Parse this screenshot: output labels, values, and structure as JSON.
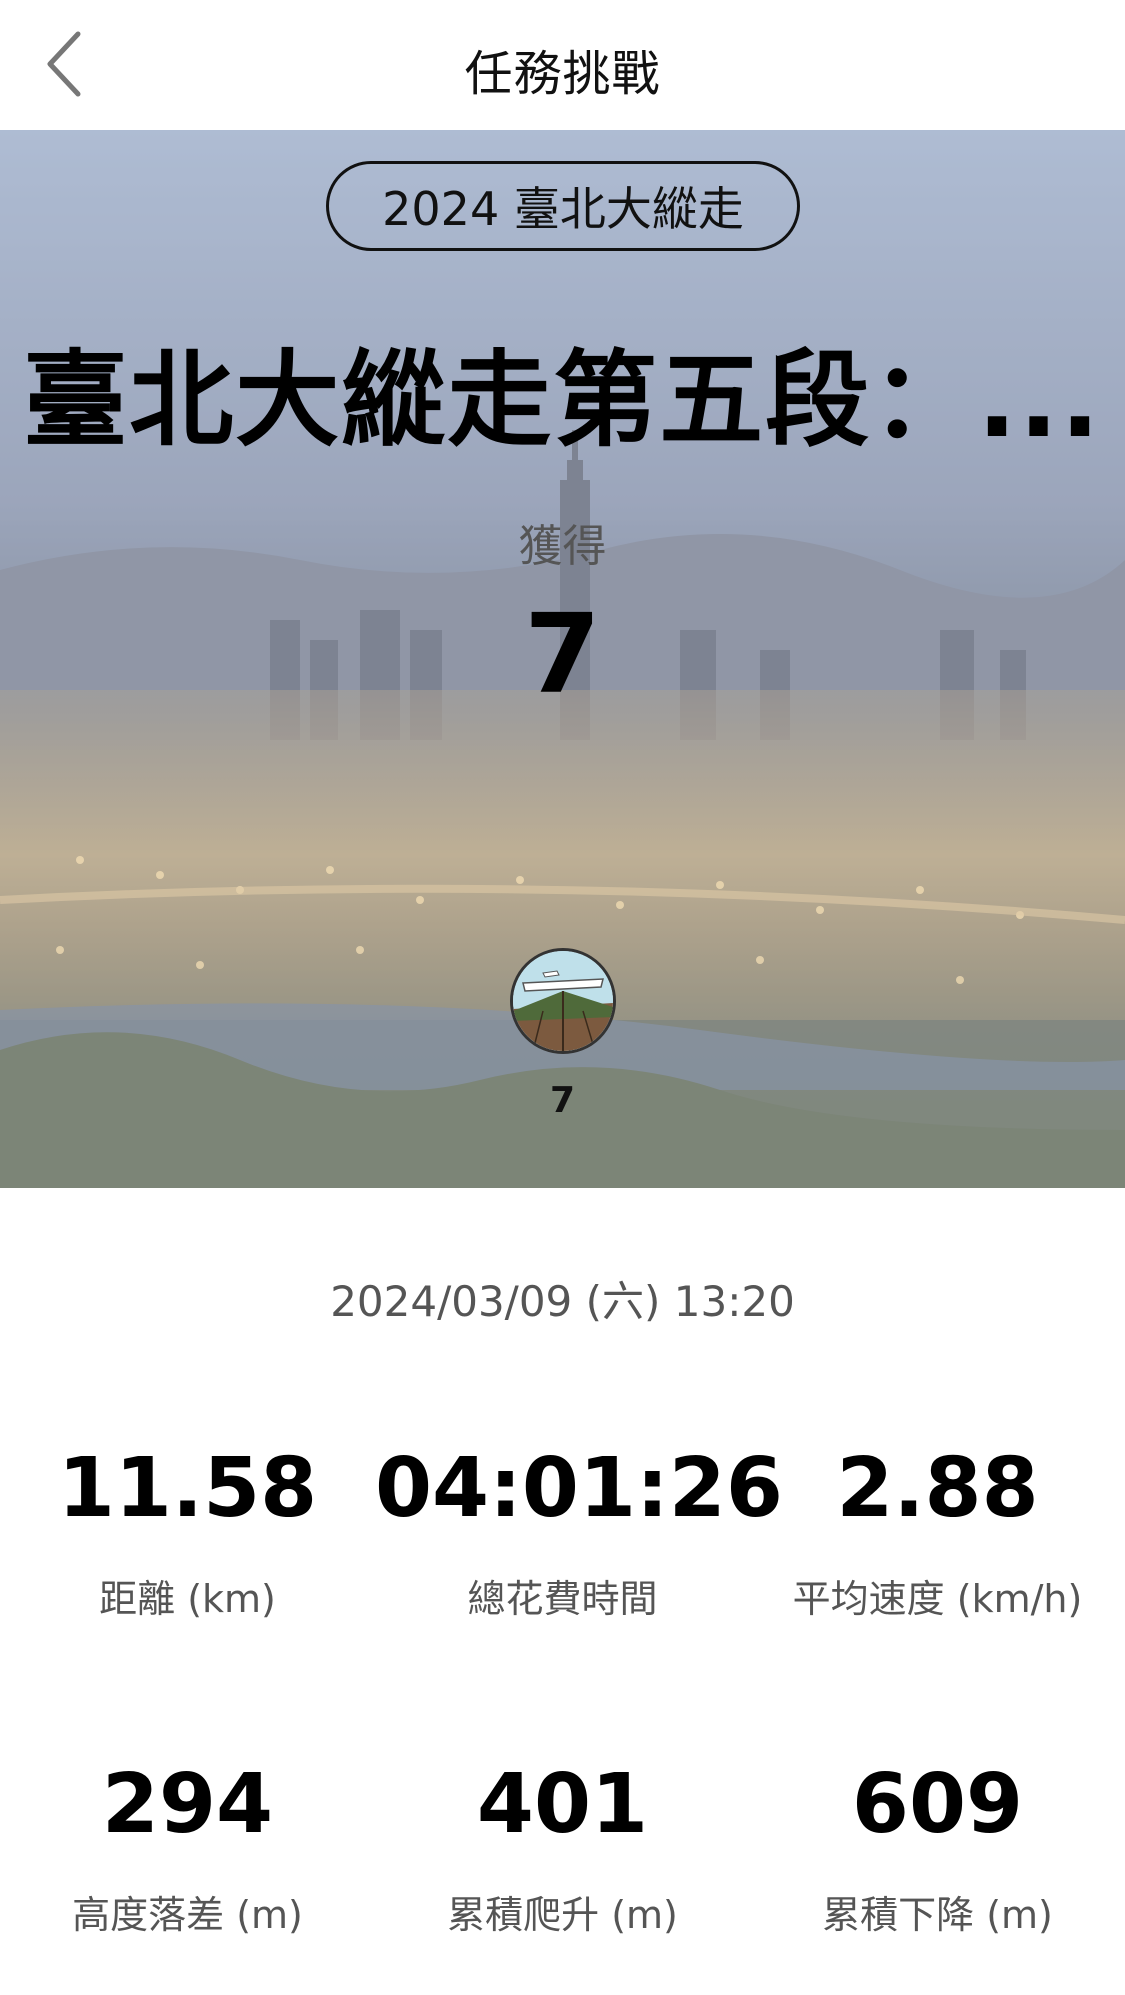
{
  "header": {
    "title": "任務挑戰",
    "back_icon": "chevron-left-icon"
  },
  "hero": {
    "event_tag": "2024 臺北大縱走",
    "mission_title": "臺北大縱走第五段：...",
    "earned_label": "獲得",
    "earned_value": "7",
    "badge_icon": "badge-icon",
    "badge_count": "7"
  },
  "activity": {
    "datetime": "2024/03/09 (六) 13:20"
  },
  "stats": [
    {
      "value": "11.58",
      "label": "距離 (km)"
    },
    {
      "value": "04:01:26",
      "label": "總花費時間"
    },
    {
      "value": "2.88",
      "label": "平均速度 (km/h)"
    },
    {
      "value": "294",
      "label": "高度落差 (m)"
    },
    {
      "value": "401",
      "label": "累積爬升 (m)"
    },
    {
      "value": "609",
      "label": "累積下降 (m)"
    }
  ]
}
